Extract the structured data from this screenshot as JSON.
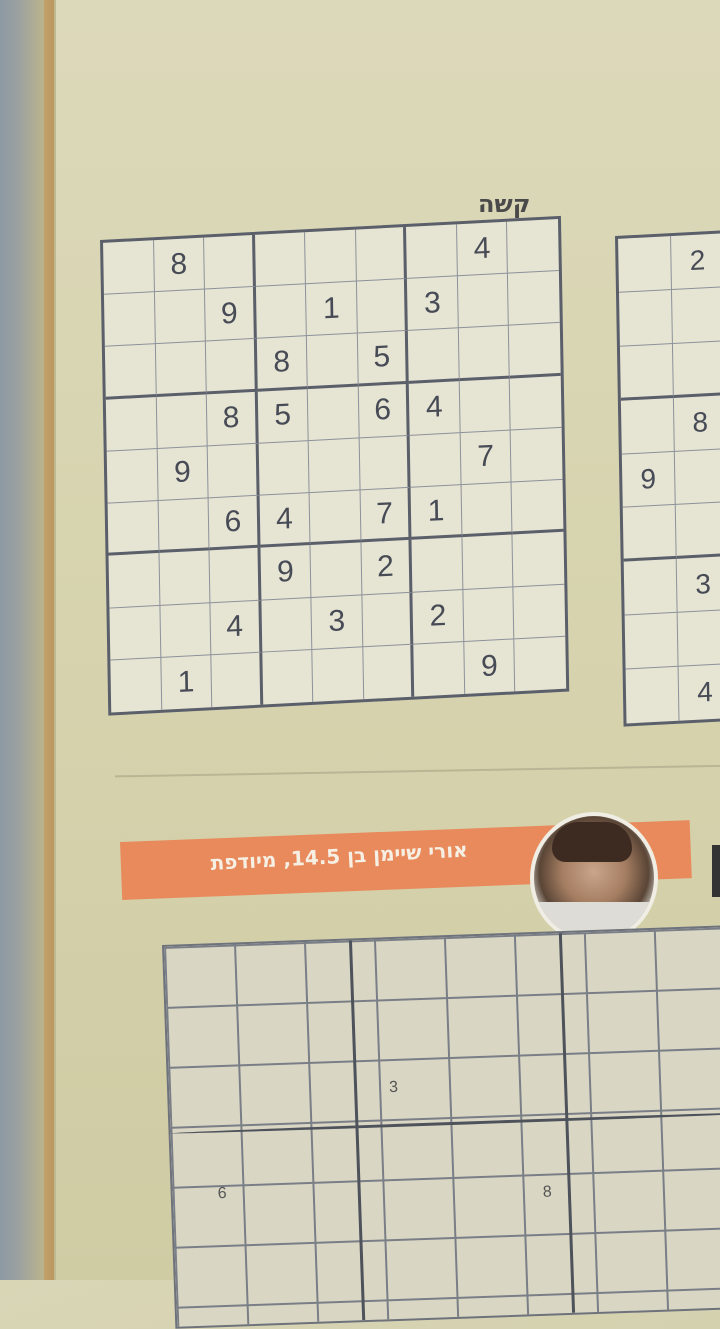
{
  "difficulty_label": "קשה",
  "sudoku": [
    [
      "",
      "8",
      "",
      "",
      "",
      "",
      "",
      "4",
      ""
    ],
    [
      "",
      "",
      "9",
      "",
      "1",
      "",
      "3",
      "",
      ""
    ],
    [
      "",
      "",
      "",
      "8",
      "",
      "5",
      "",
      "",
      ""
    ],
    [
      "",
      "",
      "8",
      "5",
      "",
      "6",
      "4",
      "",
      ""
    ],
    [
      "",
      "9",
      "",
      "",
      "",
      "",
      "",
      "7",
      ""
    ],
    [
      "",
      "",
      "6",
      "4",
      "",
      "7",
      "1",
      "",
      ""
    ],
    [
      "",
      "",
      "",
      "9",
      "",
      "2",
      "",
      "",
      ""
    ],
    [
      "",
      "",
      "4",
      "",
      "3",
      "",
      "2",
      "",
      ""
    ],
    [
      "",
      "1",
      "",
      "",
      "",
      "",
      "",
      "9",
      ""
    ]
  ],
  "sudoku_partial": {
    "cells": [
      [
        "",
        "2",
        ""
      ],
      [
        "",
        "",
        ""
      ],
      [
        "",
        "",
        ""
      ],
      [
        "",
        "8",
        ""
      ],
      [
        "9",
        "",
        ""
      ],
      [
        "",
        "",
        ""
      ],
      [
        "",
        "3",
        ""
      ],
      [
        "",
        "",
        ""
      ],
      [
        "",
        "4",
        ""
      ]
    ]
  },
  "banner": {
    "text": "אורי שיימן בן 14.5, מיודפת"
  },
  "kakuro_numbers": [
    "3",
    "6",
    "8"
  ]
}
